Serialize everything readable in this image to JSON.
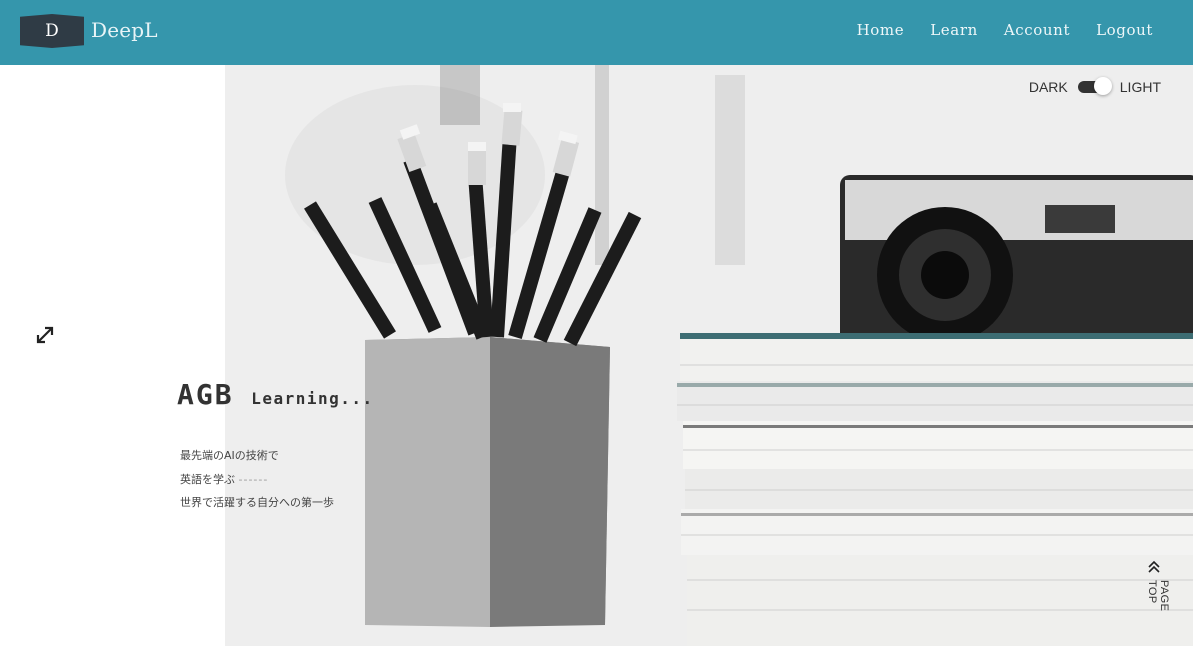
{
  "header": {
    "logo_letter": "D",
    "brand": "DeepL",
    "nav": [
      "Home",
      "Learn",
      "Account",
      "Logout"
    ]
  },
  "theme_toggle": {
    "dark_label": "DARK",
    "light_label": "LIGHT",
    "state": "light"
  },
  "hero": {
    "title_main": "AGB",
    "title_sub": "Learning...",
    "lines": [
      "最先端のAIの技術で",
      "英語を学ぶ",
      "世界で活躍する自分への第一歩"
    ],
    "dash": "------"
  },
  "page_top_label": "PAGE TOP",
  "colors": {
    "header": "#3596ac",
    "logo_bg": "#2f3b45",
    "text": "#333333"
  },
  "icons": [
    "expand-icon",
    "double-chevron-up-icon"
  ]
}
